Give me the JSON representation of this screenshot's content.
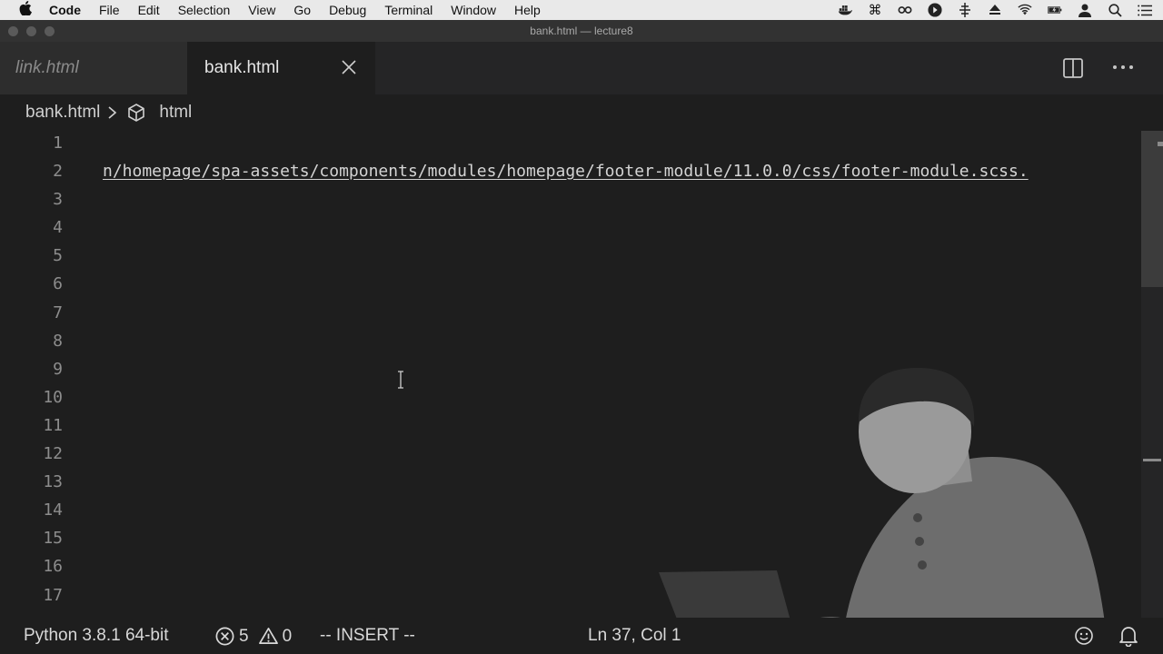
{
  "menubar": {
    "apple": "",
    "items": [
      "Code",
      "File",
      "Edit",
      "Selection",
      "View",
      "Go",
      "Debug",
      "Terminal",
      "Window",
      "Help"
    ],
    "status_icons": [
      "docker-icon",
      "command-icon",
      "link-icon",
      "play-circle-icon",
      "move-icon",
      "eject-icon",
      "wifi-icon",
      "battery-icon",
      "user-icon",
      "search-icon",
      "list-icon"
    ]
  },
  "window": {
    "title": "bank.html — lecture8"
  },
  "tabs": [
    {
      "label": "link.html",
      "active": false
    },
    {
      "label": "bank.html",
      "active": true
    }
  ],
  "breadcrumb": {
    "file": "bank.html",
    "symbol": "html"
  },
  "editor": {
    "line_numbers": [
      "1",
      "2",
      "3",
      "4",
      "5",
      "6",
      "7",
      "8",
      "9",
      "10",
      "11",
      "12",
      "13",
      "14",
      "15",
      "16",
      "17"
    ],
    "lines": [
      "",
      "n/homepage/spa-assets/components/modules/homepage/footer-module/11.0.0/css/footer-module.scss.",
      "",
      "",
      "",
      "",
      "",
      "",
      "",
      "",
      "",
      "",
      "",
      "",
      "",
      "",
      ""
    ]
  },
  "statusbar": {
    "python": "Python 3.8.1 64-bit",
    "errors": "5",
    "warnings": "0",
    "mode": "-- INSERT --",
    "position": "Ln 37, Col 1"
  },
  "colors": {
    "editor_bg": "#1e1e1e",
    "tabbar_bg": "#252526",
    "menubar_bg": "#e9e9e9"
  }
}
